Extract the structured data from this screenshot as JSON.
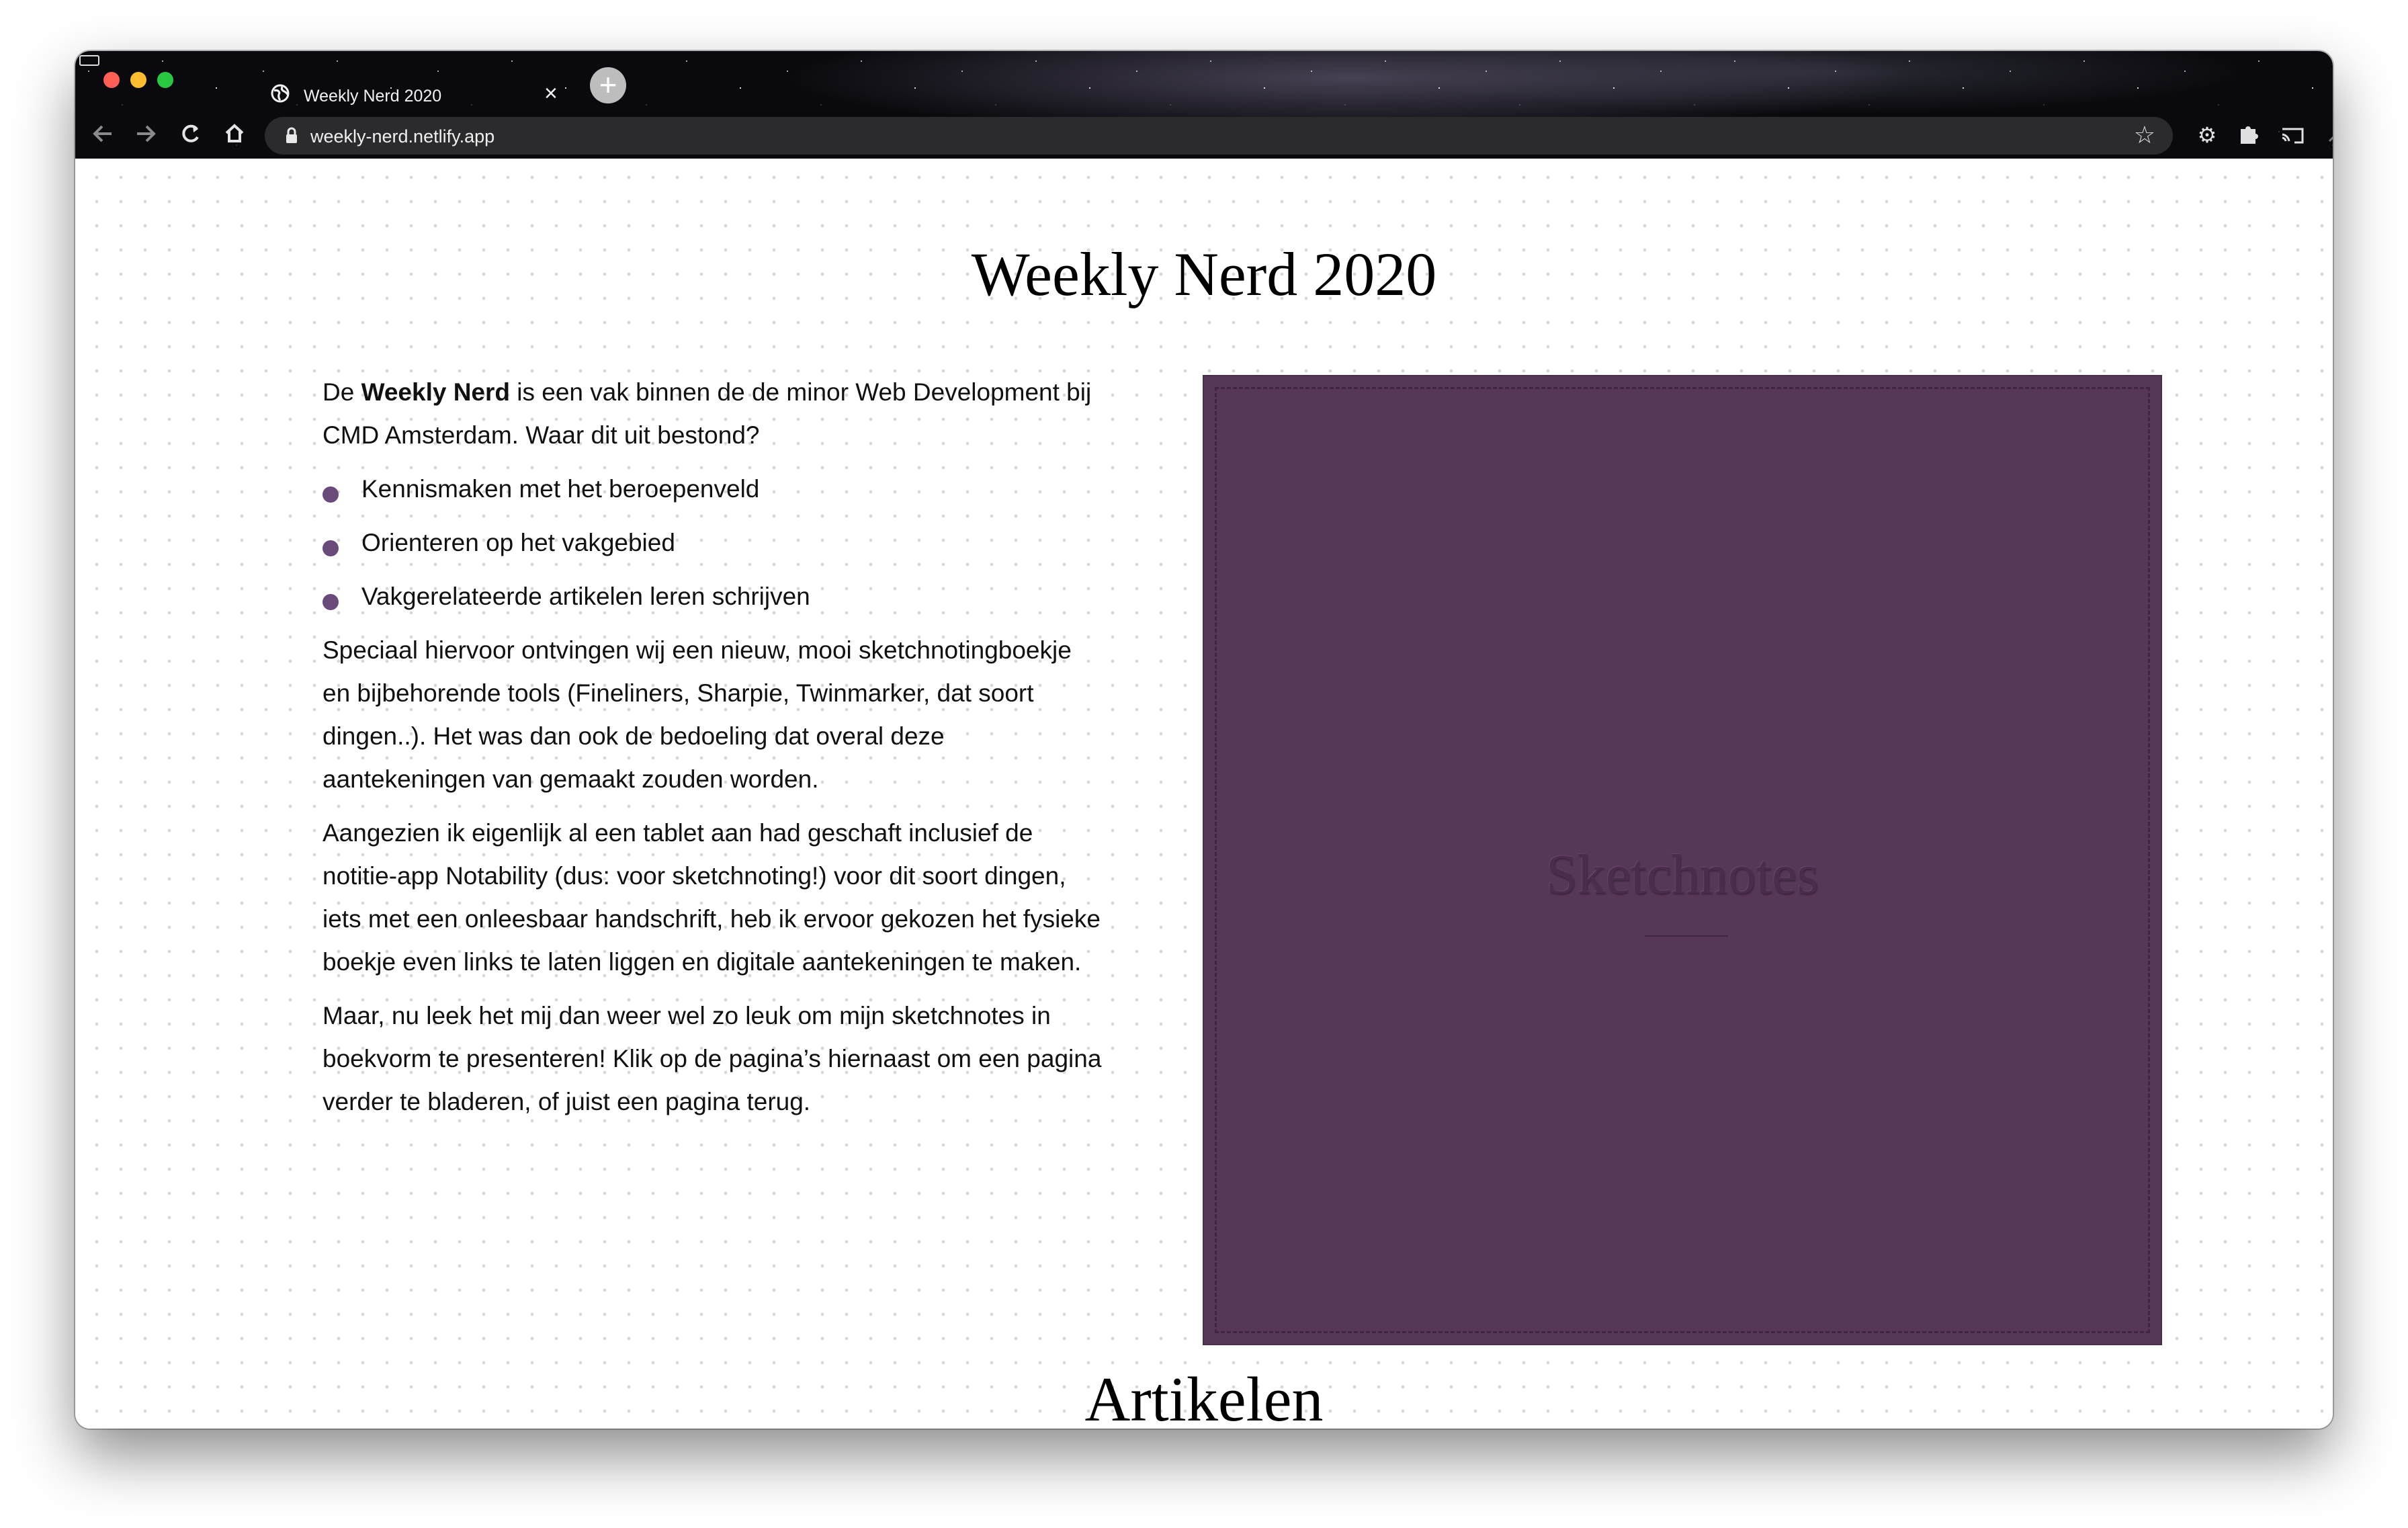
{
  "browser": {
    "tab_title": "Weekly Nerd 2020",
    "tab_close": "×",
    "new_tab": "+",
    "url": "weekly-nerd.netlify.app",
    "icons": {
      "back": "back-arrow-icon",
      "forward": "forward-arrow-icon",
      "reload": "reload-icon",
      "home": "home-icon",
      "lock": "lock-icon",
      "bookmark": "star-icon",
      "settings": "gear-icon",
      "extensions": "puzzle-icon",
      "cast": "cast-icon",
      "sync": "sync-icon",
      "profile": "profile-icon"
    }
  },
  "page": {
    "title": "Weekly Nerd 2020",
    "intro_prefix": "De ",
    "intro_bold": "Weekly Nerd",
    "intro_suffix": " is een vak binnen de de minor Web Development bij CMD Amsterdam. Waar dit uit bestond?",
    "list": [
      "Kennismaken met het beroepenveld",
      "Orienteren op het vakgebied",
      "Vakgerelateerde artikelen leren schrijven"
    ],
    "paragraphs": [
      "Speciaal hiervoor ontvingen wij een nieuw, mooi sketchnotingboekje en bijbehorende tools (Fineliners, Sharpie, Twinmarker, dat soort dingen..). Het was dan ook de bedoeling dat overal deze aantekeningen van gemaakt zouden worden.",
      "Aangezien ik eigenlijk al een tablet aan had geschaft inclusief de notitie-app Notability (dus: voor sketchnoting!) voor dit soort dingen, iets met een onleesbaar handschrift, heb ik ervoor gekozen het fysieke boekje even links te laten liggen en digitale aantekeningen te maken.",
      "Maar, nu leek het mij dan weer wel zo leuk om mijn sketchnotes in boekvorm te presenteren! Klik op de pagina’s hiernaast om een pagina verder te bladeren, of juist een pagina terug."
    ],
    "book_title": "Sketchnotes",
    "book_color": "#573758",
    "bullet_color": "#6a4a78",
    "section_title": "Artikelen"
  }
}
